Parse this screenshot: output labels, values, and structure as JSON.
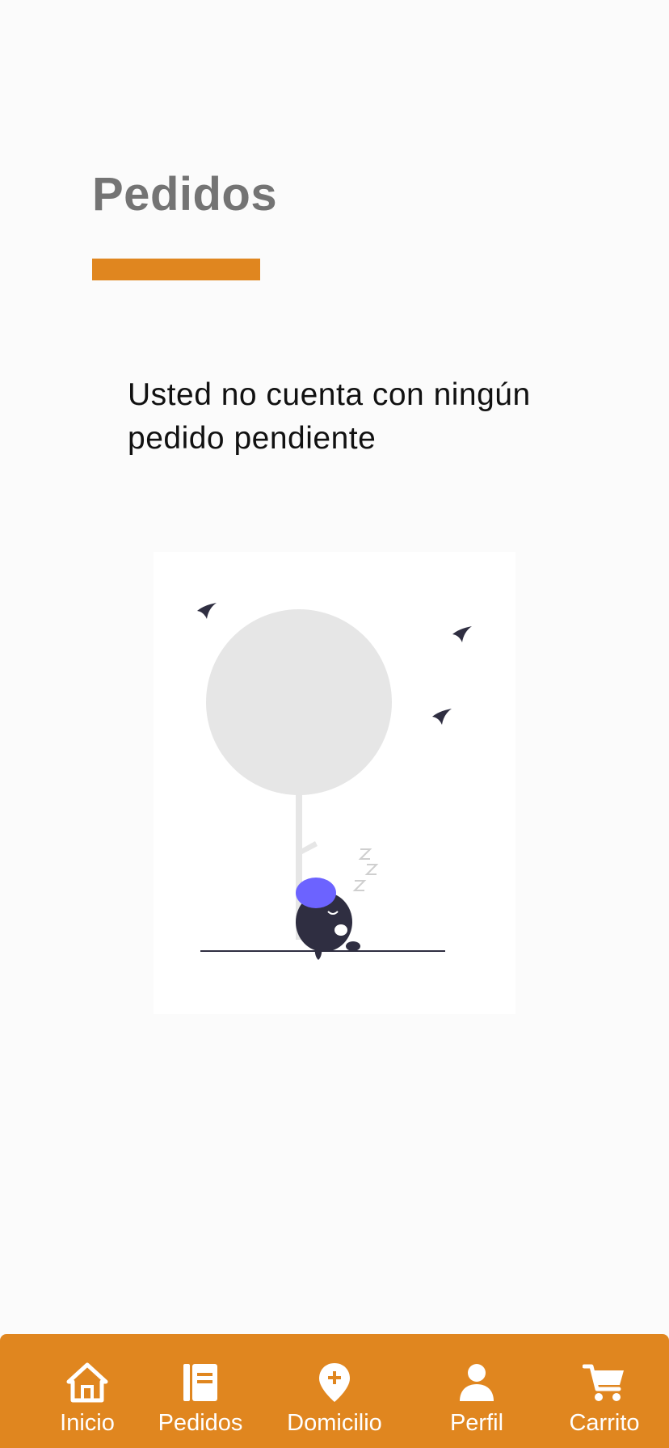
{
  "page": {
    "title": "Pedidos",
    "empty_message": "Usted no cuenta con ningún pedido pendiente"
  },
  "illustration": {
    "name": "sleeping-character-under-tree",
    "snore_text": "Z Z Z"
  },
  "bottom_nav": {
    "items": [
      {
        "label": "Inicio",
        "icon": "home-icon"
      },
      {
        "label": "Pedidos",
        "icon": "orders-book-icon"
      },
      {
        "label": "Domicilio",
        "icon": "location-pin-icon"
      },
      {
        "label": "Perfil",
        "icon": "person-icon"
      },
      {
        "label": "Carrito",
        "icon": "cart-icon"
      }
    ]
  },
  "colors": {
    "accent": "#e0861f",
    "background": "#fbfbfb",
    "title": "#747474",
    "text": "#111111",
    "nav_text": "#ffffff",
    "illustration_purple": "#6c63ff",
    "illustration_dark": "#2f2e41",
    "illustration_tree": "#e6e6e6"
  }
}
